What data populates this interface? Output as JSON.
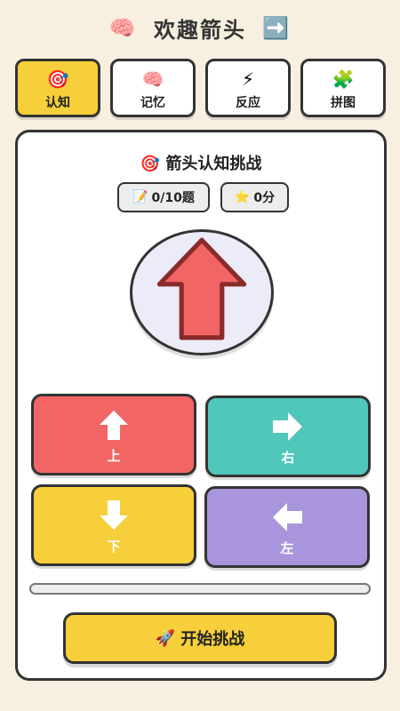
{
  "header": {
    "emoji_left": "🧠",
    "title": "欢趣箭头",
    "emoji_right": "➡️"
  },
  "tabs": [
    {
      "icon": "🎯",
      "label": "认知",
      "active": true
    },
    {
      "icon": "🧠",
      "label": "记忆",
      "active": false
    },
    {
      "icon": "⚡",
      "label": "反应",
      "active": false
    },
    {
      "icon": "🧩",
      "label": "拼图",
      "active": false
    }
  ],
  "challenge": {
    "title_icon": "🎯",
    "title": "箭头认知挑战",
    "progress_icon": "📝",
    "progress_text": "0/10题",
    "score_icon": "⭐",
    "score_text": "0分",
    "target_arrow": "up",
    "target_arrow_color": "#f26565"
  },
  "answers": [
    {
      "direction": "up",
      "label": "上",
      "color": "#f26565"
    },
    {
      "direction": "right",
      "label": "右",
      "color": "#4fc7bb"
    },
    {
      "direction": "down",
      "label": "下",
      "color": "#f6cf3a"
    },
    {
      "direction": "left",
      "label": "左",
      "color": "#a895db"
    }
  ],
  "progress_fraction": 0,
  "start_button": {
    "icon": "🚀",
    "label": "开始挑战"
  }
}
